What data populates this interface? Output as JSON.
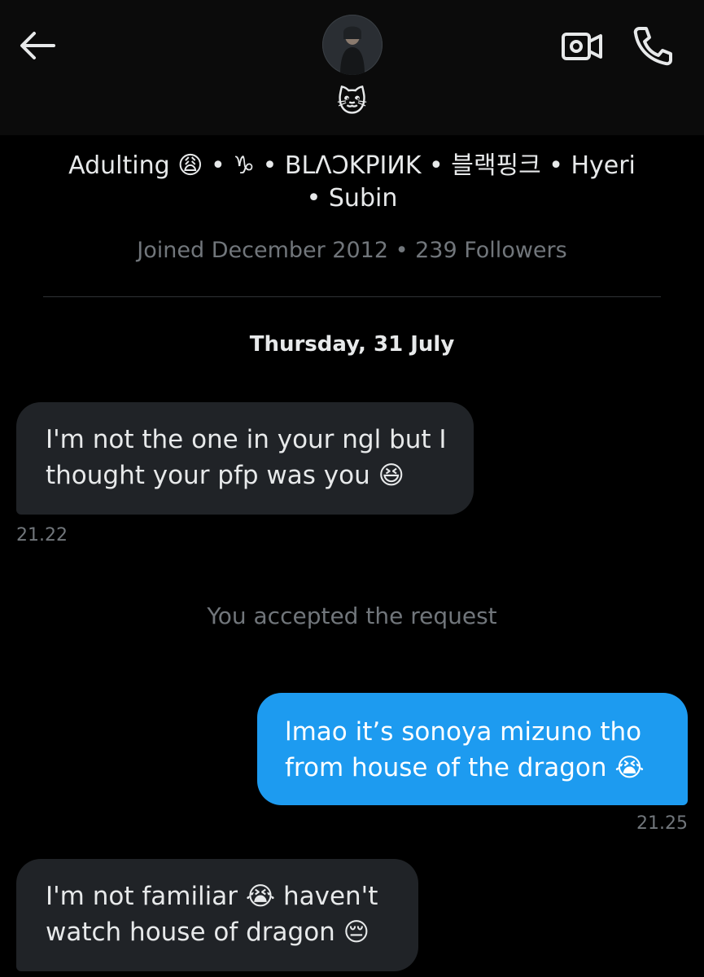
{
  "header": {
    "display_name": "🐱",
    "bio_line1": "Adulting 😩 • ♑ • BLΛƆKPIИK • 블랙핑크 • Hyeri",
    "bio_line2": "• Subin",
    "joined": "Joined December 2012 • 239 Followers",
    "icons": {
      "back": "arrow-left-icon",
      "video": "video-camera-icon",
      "call": "phone-icon"
    }
  },
  "conversation": {
    "date_separator": "Thursday, 31 July",
    "system_message": "You accepted the request",
    "messages": [
      {
        "direction": "incoming",
        "lines": [
          "I'm not the one in your ngl but I",
          "thought your pfp was you 😆"
        ],
        "time": "21.22"
      },
      {
        "direction": "outgoing",
        "lines": [
          "lmao it’s sonoya mizuno tho",
          "from house of the dragon 😭"
        ],
        "time": "21.25"
      },
      {
        "direction": "incoming",
        "lines": [
          "I'm not familiar 😭 haven't",
          "watch house of dragon 😔"
        ]
      }
    ]
  },
  "colors": {
    "background": "#000000",
    "header_bg": "#0b0b0b",
    "incoming_bubble": "#202327",
    "outgoing_bubble": "#1d9bf0",
    "muted_text": "#71767b"
  }
}
